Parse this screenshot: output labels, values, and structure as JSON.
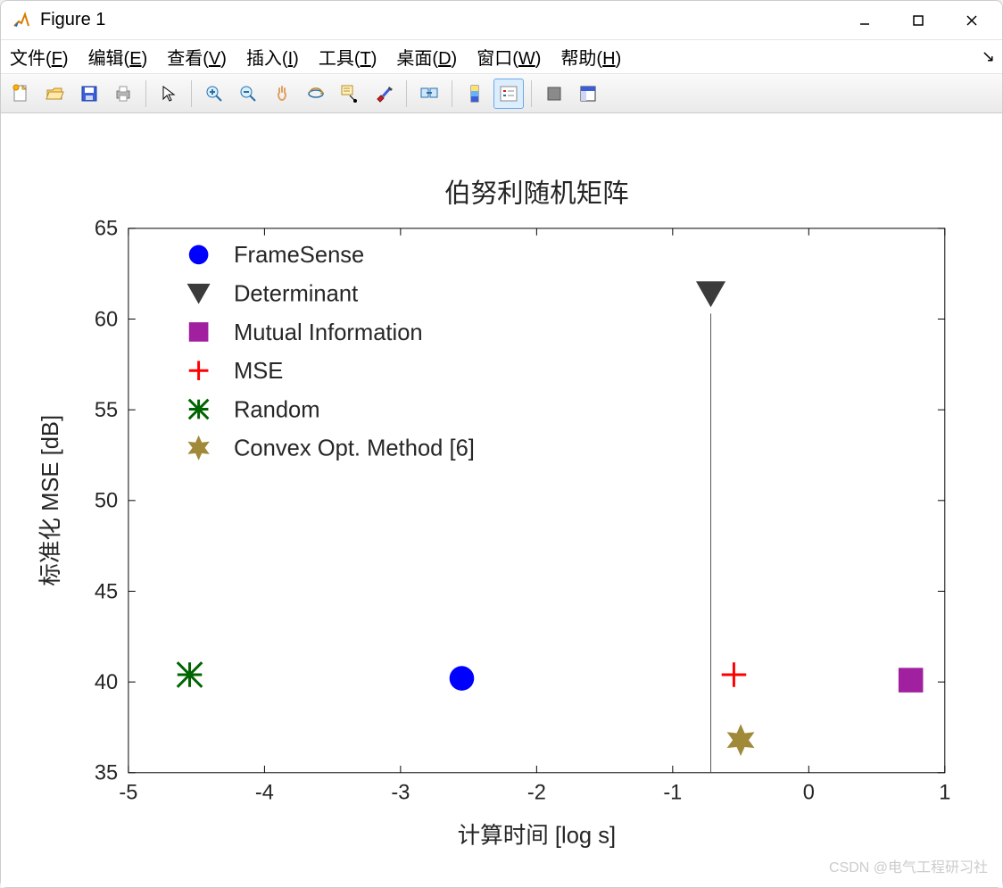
{
  "window": {
    "title": "Figure 1"
  },
  "menubar": {
    "file": "文件(F)",
    "edit": "编辑(E)",
    "view": "查看(V)",
    "insert": "插入(I)",
    "tools": "工具(T)",
    "desktop": "桌面(D)",
    "window": "窗口(W)",
    "help": "帮助(H)"
  },
  "toolbar": {
    "new": "new-figure",
    "open": "open",
    "save": "save",
    "print": "print",
    "pointer": "pointer",
    "zoom_in": "zoom-in",
    "zoom_out": "zoom-out",
    "pan": "pan",
    "rotate3d": "rotate-3d",
    "datacursor": "data-cursor",
    "brush": "brush",
    "link": "link-plots",
    "colorbar": "insert-colorbar",
    "legend": "insert-legend",
    "hide": "hide-tools",
    "dock": "dock-figure"
  },
  "chart_data": {
    "type": "scatter",
    "title": "伯努利随机矩阵",
    "xlabel": "计算时间 [log s]",
    "ylabel": "标准化 MSE [dB]",
    "xlim": [
      -5,
      1
    ],
    "ylim": [
      35,
      65
    ],
    "xticks": [
      -5,
      -4,
      -3,
      -2,
      -1,
      0,
      1
    ],
    "yticks": [
      35,
      40,
      45,
      50,
      55,
      60,
      65
    ],
    "series": [
      {
        "name": "FrameSense",
        "marker": "circle",
        "color": "#0000ff",
        "points": [
          {
            "x": -2.55,
            "y": 40.2
          }
        ]
      },
      {
        "name": "Determinant",
        "marker": "triangle_down",
        "color": "#3b3b3b",
        "points": [
          {
            "x": -0.72,
            "y": 61.4
          }
        ]
      },
      {
        "name": "Mutual Information",
        "marker": "square",
        "color": "#a020a0",
        "points": [
          {
            "x": 0.75,
            "y": 40.1
          }
        ]
      },
      {
        "name": "MSE",
        "marker": "plus",
        "color": "#ff0000",
        "points": [
          {
            "x": -0.55,
            "y": 40.4
          }
        ]
      },
      {
        "name": "Random",
        "marker": "x",
        "color": "#006400",
        "points": [
          {
            "x": -4.55,
            "y": 40.4
          }
        ]
      },
      {
        "name": "Convex Opt. Method [6]",
        "marker": "star6",
        "color": "#a08a3a",
        "points": [
          {
            "x": -0.5,
            "y": 36.8
          }
        ]
      }
    ],
    "annotations": [
      {
        "type": "vline",
        "x": -0.72,
        "y0": 35,
        "y1": 60.3
      }
    ]
  },
  "watermark": "CSDN @电气工程研习社"
}
